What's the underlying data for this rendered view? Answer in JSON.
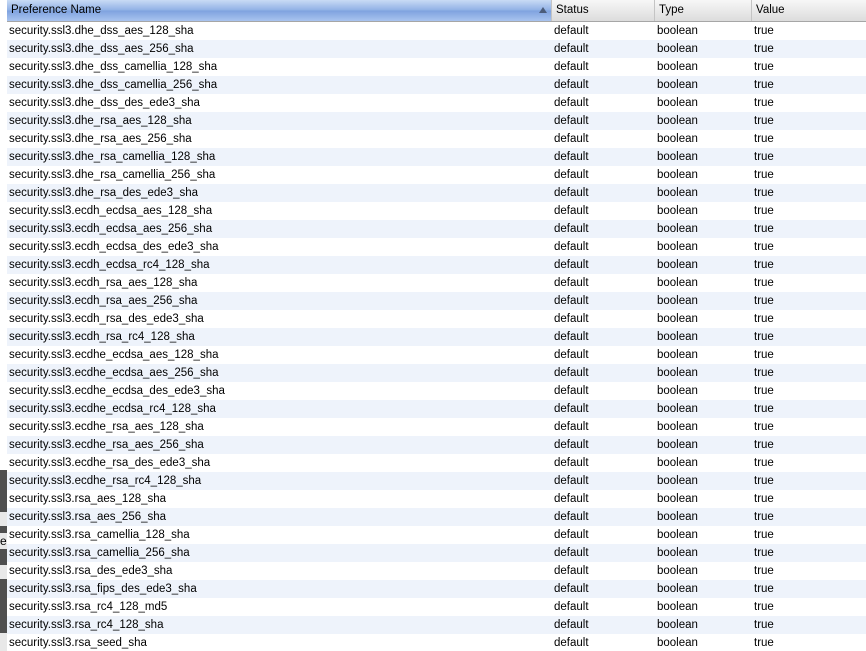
{
  "columns": {
    "name": "Preference Name",
    "status": "Status",
    "type": "Type",
    "value": "Value"
  },
  "behind_window_char": "e",
  "rows": [
    {
      "name": "security.ssl3.dhe_dss_aes_128_sha",
      "status": "default",
      "type": "boolean",
      "value": "true"
    },
    {
      "name": "security.ssl3.dhe_dss_aes_256_sha",
      "status": "default",
      "type": "boolean",
      "value": "true"
    },
    {
      "name": "security.ssl3.dhe_dss_camellia_128_sha",
      "status": "default",
      "type": "boolean",
      "value": "true"
    },
    {
      "name": "security.ssl3.dhe_dss_camellia_256_sha",
      "status": "default",
      "type": "boolean",
      "value": "true"
    },
    {
      "name": "security.ssl3.dhe_dss_des_ede3_sha",
      "status": "default",
      "type": "boolean",
      "value": "true"
    },
    {
      "name": "security.ssl3.dhe_rsa_aes_128_sha",
      "status": "default",
      "type": "boolean",
      "value": "true"
    },
    {
      "name": "security.ssl3.dhe_rsa_aes_256_sha",
      "status": "default",
      "type": "boolean",
      "value": "true"
    },
    {
      "name": "security.ssl3.dhe_rsa_camellia_128_sha",
      "status": "default",
      "type": "boolean",
      "value": "true"
    },
    {
      "name": "security.ssl3.dhe_rsa_camellia_256_sha",
      "status": "default",
      "type": "boolean",
      "value": "true"
    },
    {
      "name": "security.ssl3.dhe_rsa_des_ede3_sha",
      "status": "default",
      "type": "boolean",
      "value": "true"
    },
    {
      "name": "security.ssl3.ecdh_ecdsa_aes_128_sha",
      "status": "default",
      "type": "boolean",
      "value": "true"
    },
    {
      "name": "security.ssl3.ecdh_ecdsa_aes_256_sha",
      "status": "default",
      "type": "boolean",
      "value": "true"
    },
    {
      "name": "security.ssl3.ecdh_ecdsa_des_ede3_sha",
      "status": "default",
      "type": "boolean",
      "value": "true"
    },
    {
      "name": "security.ssl3.ecdh_ecdsa_rc4_128_sha",
      "status": "default",
      "type": "boolean",
      "value": "true"
    },
    {
      "name": "security.ssl3.ecdh_rsa_aes_128_sha",
      "status": "default",
      "type": "boolean",
      "value": "true"
    },
    {
      "name": "security.ssl3.ecdh_rsa_aes_256_sha",
      "status": "default",
      "type": "boolean",
      "value": "true"
    },
    {
      "name": "security.ssl3.ecdh_rsa_des_ede3_sha",
      "status": "default",
      "type": "boolean",
      "value": "true"
    },
    {
      "name": "security.ssl3.ecdh_rsa_rc4_128_sha",
      "status": "default",
      "type": "boolean",
      "value": "true"
    },
    {
      "name": "security.ssl3.ecdhe_ecdsa_aes_128_sha",
      "status": "default",
      "type": "boolean",
      "value": "true"
    },
    {
      "name": "security.ssl3.ecdhe_ecdsa_aes_256_sha",
      "status": "default",
      "type": "boolean",
      "value": "true"
    },
    {
      "name": "security.ssl3.ecdhe_ecdsa_des_ede3_sha",
      "status": "default",
      "type": "boolean",
      "value": "true"
    },
    {
      "name": "security.ssl3.ecdhe_ecdsa_rc4_128_sha",
      "status": "default",
      "type": "boolean",
      "value": "true"
    },
    {
      "name": "security.ssl3.ecdhe_rsa_aes_128_sha",
      "status": "default",
      "type": "boolean",
      "value": "true"
    },
    {
      "name": "security.ssl3.ecdhe_rsa_aes_256_sha",
      "status": "default",
      "type": "boolean",
      "value": "true"
    },
    {
      "name": "security.ssl3.ecdhe_rsa_des_ede3_sha",
      "status": "default",
      "type": "boolean",
      "value": "true"
    },
    {
      "name": "security.ssl3.ecdhe_rsa_rc4_128_sha",
      "status": "default",
      "type": "boolean",
      "value": "true"
    },
    {
      "name": "security.ssl3.rsa_aes_128_sha",
      "status": "default",
      "type": "boolean",
      "value": "true"
    },
    {
      "name": "security.ssl3.rsa_aes_256_sha",
      "status": "default",
      "type": "boolean",
      "value": "true"
    },
    {
      "name": "security.ssl3.rsa_camellia_128_sha",
      "status": "default",
      "type": "boolean",
      "value": "true"
    },
    {
      "name": "security.ssl3.rsa_camellia_256_sha",
      "status": "default",
      "type": "boolean",
      "value": "true"
    },
    {
      "name": "security.ssl3.rsa_des_ede3_sha",
      "status": "default",
      "type": "boolean",
      "value": "true"
    },
    {
      "name": "security.ssl3.rsa_fips_des_ede3_sha",
      "status": "default",
      "type": "boolean",
      "value": "true"
    },
    {
      "name": "security.ssl3.rsa_rc4_128_md5",
      "status": "default",
      "type": "boolean",
      "value": "true"
    },
    {
      "name": "security.ssl3.rsa_rc4_128_sha",
      "status": "default",
      "type": "boolean",
      "value": "true"
    },
    {
      "name": "security.ssl3.rsa_seed_sha",
      "status": "default",
      "type": "boolean",
      "value": "true"
    }
  ]
}
